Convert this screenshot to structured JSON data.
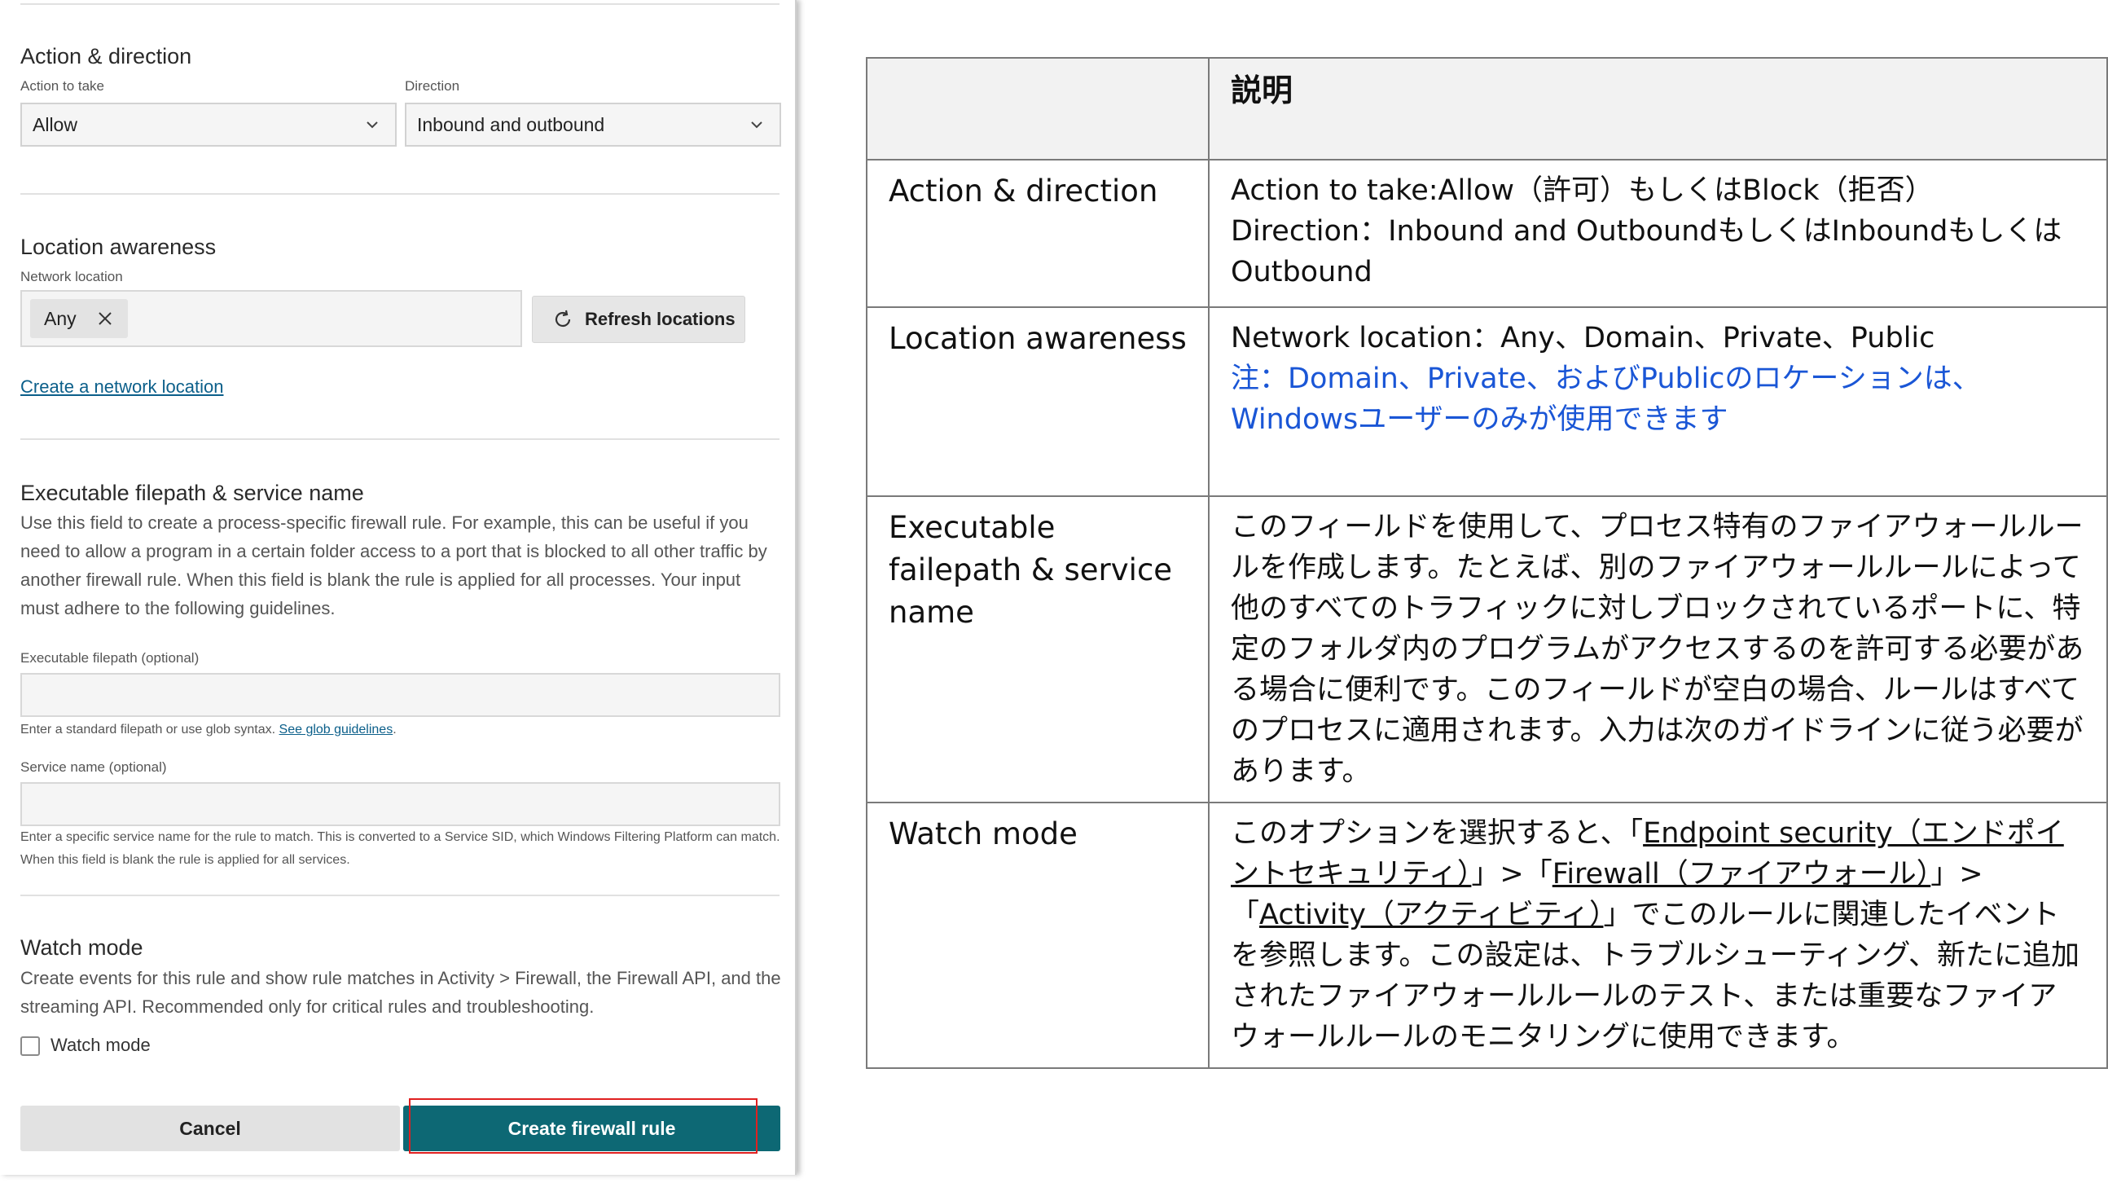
{
  "form": {
    "action_direction": {
      "title": "Action & direction",
      "action_label": "Action to take",
      "action_value": "Allow",
      "direction_label": "Direction",
      "direction_value": "Inbound and outbound"
    },
    "location": {
      "title": "Location awareness",
      "network_label": "Network location",
      "chip": "Any",
      "refresh_button": "Refresh locations",
      "create_link": "Create a network location"
    },
    "executable": {
      "title": "Executable filepath & service name",
      "description": "Use this field to create a process-specific firewall rule. For example, this can be useful if you need to allow a program in a certain folder access to a port that is blocked to all other traffic by another firewall rule. When this field is blank the rule is applied for all processes. Your input must adhere to the following guidelines.",
      "filepath_label": "Executable filepath (optional)",
      "filepath_value": "",
      "filepath_helper": "Enter a standard filepath or use glob syntax.",
      "glob_link": "See glob guidelines",
      "service_label": "Service name (optional)",
      "service_value": "",
      "service_helper": "Enter a specific service name for the rule to match. This is converted to a Service SID, which Windows Filtering Platform can match. When this field is blank the rule is applied for all services."
    },
    "watch": {
      "title": "Watch mode",
      "description": "Create events for this rule and show rule matches in Activity > Firewall, the Firewall API, and the streaming API. Recommended only for critical rules and troubleshooting.",
      "checkbox_label": "Watch mode",
      "checked": false
    },
    "buttons": {
      "cancel": "Cancel",
      "create": "Create firewall rule"
    }
  },
  "table": {
    "header": {
      "col1": "",
      "col2": "説明"
    },
    "rows": [
      {
        "name": "Action & direction",
        "line1": "Action to take:Allow（許可）もしくはBlock（拒否）",
        "line2": "Direction：Inbound and OutboundもしくはInboundもしくはOutbound"
      },
      {
        "name": "Location awareness",
        "line1": "Network location：Any、Domain、Private、Public",
        "note": "注：Domain、Private、およびPublicのロケーションは、Windowsユーザーのみが使用できます"
      },
      {
        "name": "Executable failepath & service name",
        "text": "このフィールドを使用して、プロセス特有のファイアウォールルールを作成します。たとえば、別のファイアウォールルールによって他のすべてのトラフィックに対しブロックされているポートに、特定のフォルダ内のプログラムがアクセスするのを許可する必要がある場合に便利です。このフィールドが空白の場合、ルールはすべてのプロセスに適用されます。入力は次のガイドラインに従う必要があります。"
      },
      {
        "name": "Watch mode",
        "pre": "このオプションを選択すると、「",
        "link1": "Endpoint security（エンドポイントセキュリティ）",
        "sep1": "」>「",
        "link2": "Firewall（ファイアウォール）",
        "sep2": "」>「",
        "link3": "Activity（アクティビティ）",
        "post": "」でこのルールに関連したイベントを参照します。この設定は、トラブルシューティング、新たに追加されたファイアウォールルールのテスト、または重要なファイアウォールルールのモニタリングに使用できます。"
      }
    ]
  },
  "colors": {
    "primary_button": "#0d6874",
    "link": "#0b5f8a",
    "note_blue": "#1a56d6",
    "highlight": "#e02020"
  },
  "icons": [
    "chevron-down-icon",
    "close-icon",
    "refresh-icon",
    "checkbox"
  ]
}
